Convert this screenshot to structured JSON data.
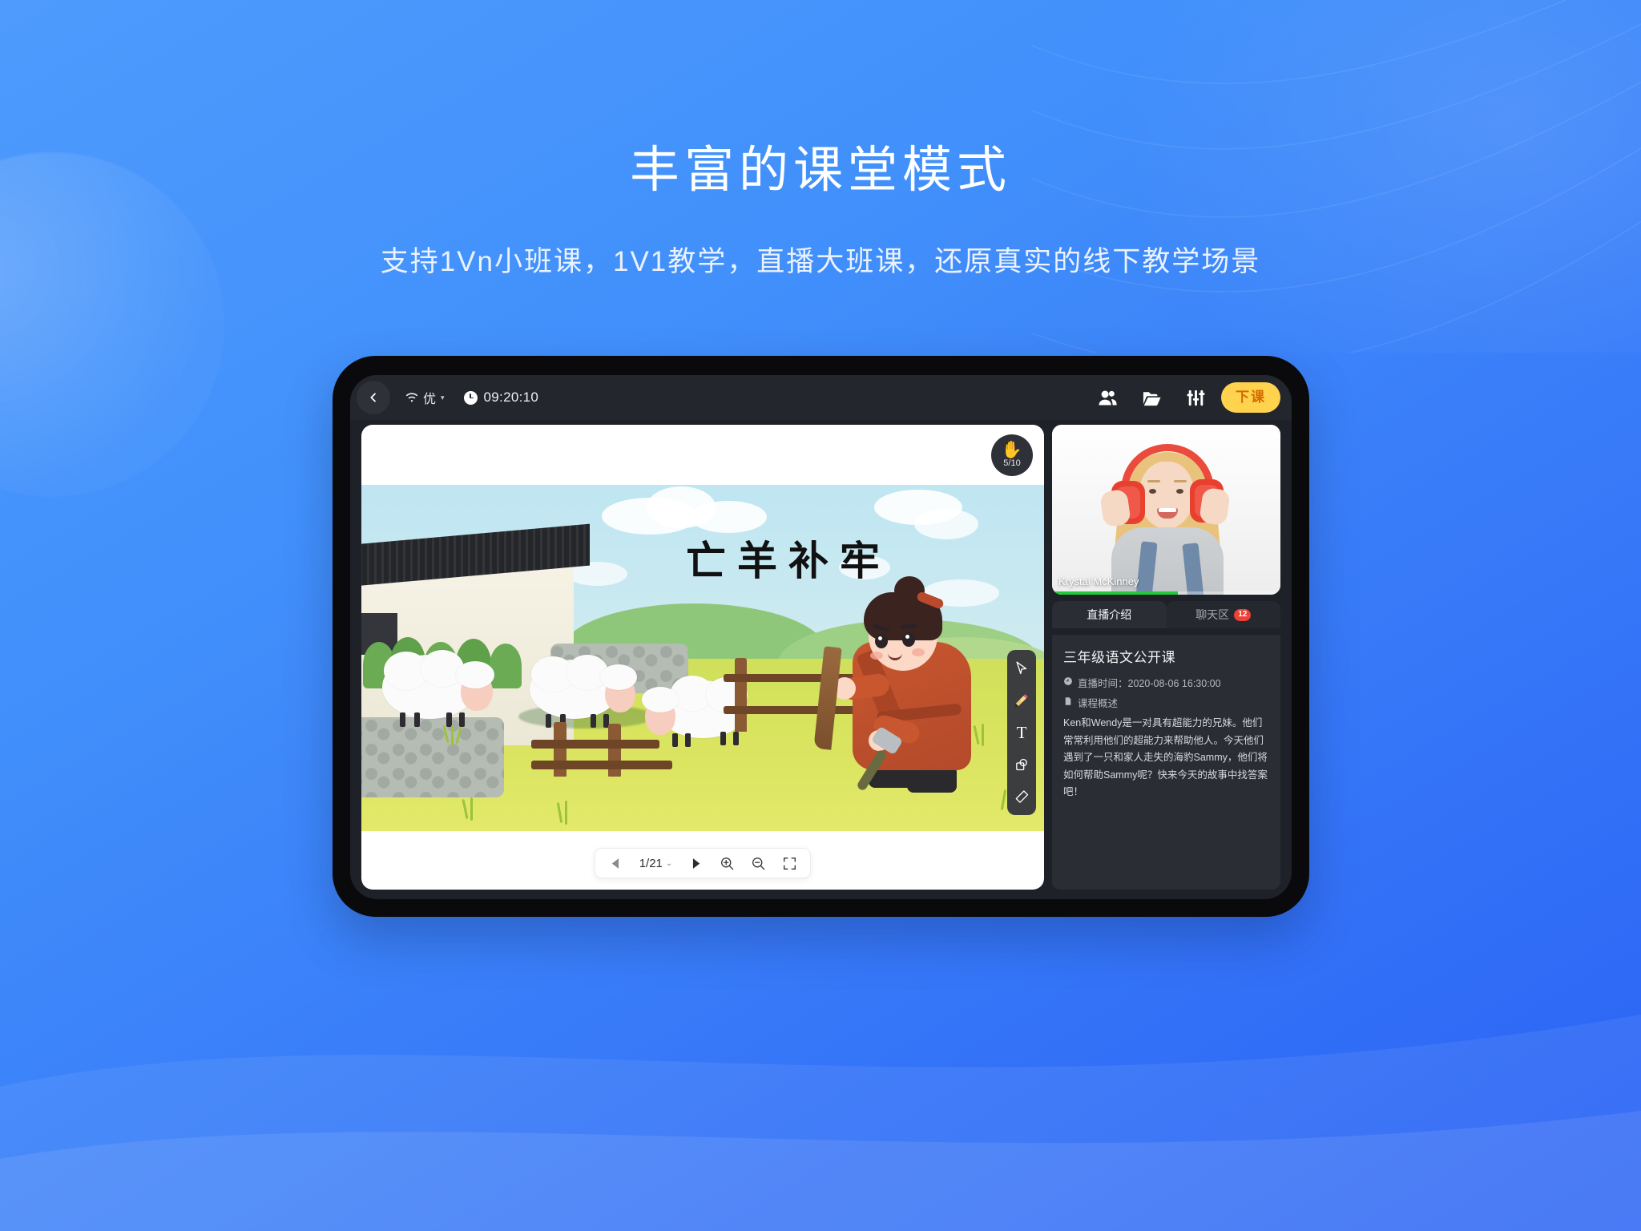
{
  "page": {
    "title": "丰富的课堂模式",
    "subtitle": "支持1Vn小班课，1V1教学，直播大班课，还原真实的线下教学场景",
    "bg_color_top": "#4e9bfd",
    "bg_color_bottom": "#2a62f5"
  },
  "topbar": {
    "back_icon": "chevron-left-icon",
    "network_quality": "优",
    "network_caret": "▾",
    "clock_icon": "clock-icon",
    "time": "09:20:10",
    "icons": [
      {
        "name": "members-icon",
        "label": "成员"
      },
      {
        "name": "folder-icon",
        "label": "课件"
      },
      {
        "name": "settings-sliders-icon",
        "label": "设置"
      }
    ],
    "end_class_label": "下课",
    "end_class_bg": "#ffd34d",
    "end_class_text_color": "#d66a00"
  },
  "stage": {
    "hand_icon": "raise-hand-icon",
    "hand_count": "5/10",
    "slide_title": "亡羊补牢",
    "tools": [
      {
        "name": "cursor-tool",
        "label": "选择"
      },
      {
        "name": "pencil-tool",
        "label": "画笔",
        "active": true
      },
      {
        "name": "text-tool",
        "label": "文字",
        "glyph": "T"
      },
      {
        "name": "shape-tool",
        "label": "图形"
      },
      {
        "name": "eraser-tool",
        "label": "橡皮"
      }
    ],
    "pagebar": {
      "prev_icon": "triangle-left-icon",
      "page_indicator": "1/21",
      "page_caret": "⌄",
      "next_icon": "triangle-right-icon",
      "zoom_in_icon": "zoom-in-icon",
      "zoom_out_icon": "zoom-out-icon",
      "fullscreen_icon": "fullscreen-icon"
    }
  },
  "right_panel": {
    "video": {
      "teacher_name": "Krystal McKinney",
      "progress_percent": 55,
      "progress_color": "#22c93d"
    },
    "tabs": [
      {
        "label": "直播介绍",
        "active": true,
        "badge": null
      },
      {
        "label": "聊天区",
        "active": false,
        "badge": "12"
      }
    ],
    "course": {
      "title": "三年级语文公开课",
      "time_icon": "clock-icon",
      "time_label": "直播时间：",
      "time_value": "2020-08-06 16:30:00",
      "overview_icon": "document-icon",
      "overview_label": "课程概述",
      "description": "Ken和Wendy是一对具有超能力的兄妹。他们常常利用他们的超能力来帮助他人。今天他们遇到了一只和家人走失的海豹Sammy，他们将如何帮助Sammy呢？快来今天的故事中找答案吧！"
    }
  }
}
